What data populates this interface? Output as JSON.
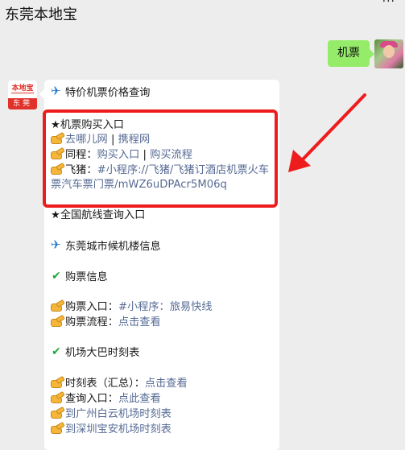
{
  "header": {
    "title": "东莞本地宝",
    "more": "···"
  },
  "outgoing": {
    "text": "机票"
  },
  "bot": {
    "logo_top": "本地宝",
    "logo_band": "东莞"
  },
  "message": {
    "line1": "特价机票价格查询",
    "buy_title": "★机票购买入口",
    "buy_qunar": "去哪儿网",
    "sep": " | ",
    "buy_ctrip": "携程网",
    "tongcheng_label": "同程：",
    "tongcheng_buy": "购买入口",
    "tongcheng_flow": "购买流程",
    "feizhu_label": "飞猪：",
    "feizhu_link": "#小程序://飞猪/飞猪订酒店机票火车票汽车票门票/mWZ6uDPAcr5M06q",
    "route_query": "★全国航线查询入口",
    "terminal_info": "东莞城市候机楼信息",
    "ticket_info": "购票信息",
    "ticket_entry_label": "购票入口：",
    "ticket_entry_link": "#小程序：旅易快线",
    "ticket_flow_label": "购票流程：",
    "ticket_flow_link": "点击查看",
    "bus_schedule": "机场大巴时刻表",
    "schedule_label": "时刻表（汇总）：",
    "schedule_link": "点击查看",
    "query_label": "查询入口：",
    "query_link": "点此查看",
    "baiyun_link": "到广州白云机场时刻表",
    "baoan_link": "到深圳宝安机场时刻表"
  },
  "colors": {
    "link": "#576b95",
    "highlight_box": "#ee1c1c",
    "bubble_out": "#95ec69"
  }
}
